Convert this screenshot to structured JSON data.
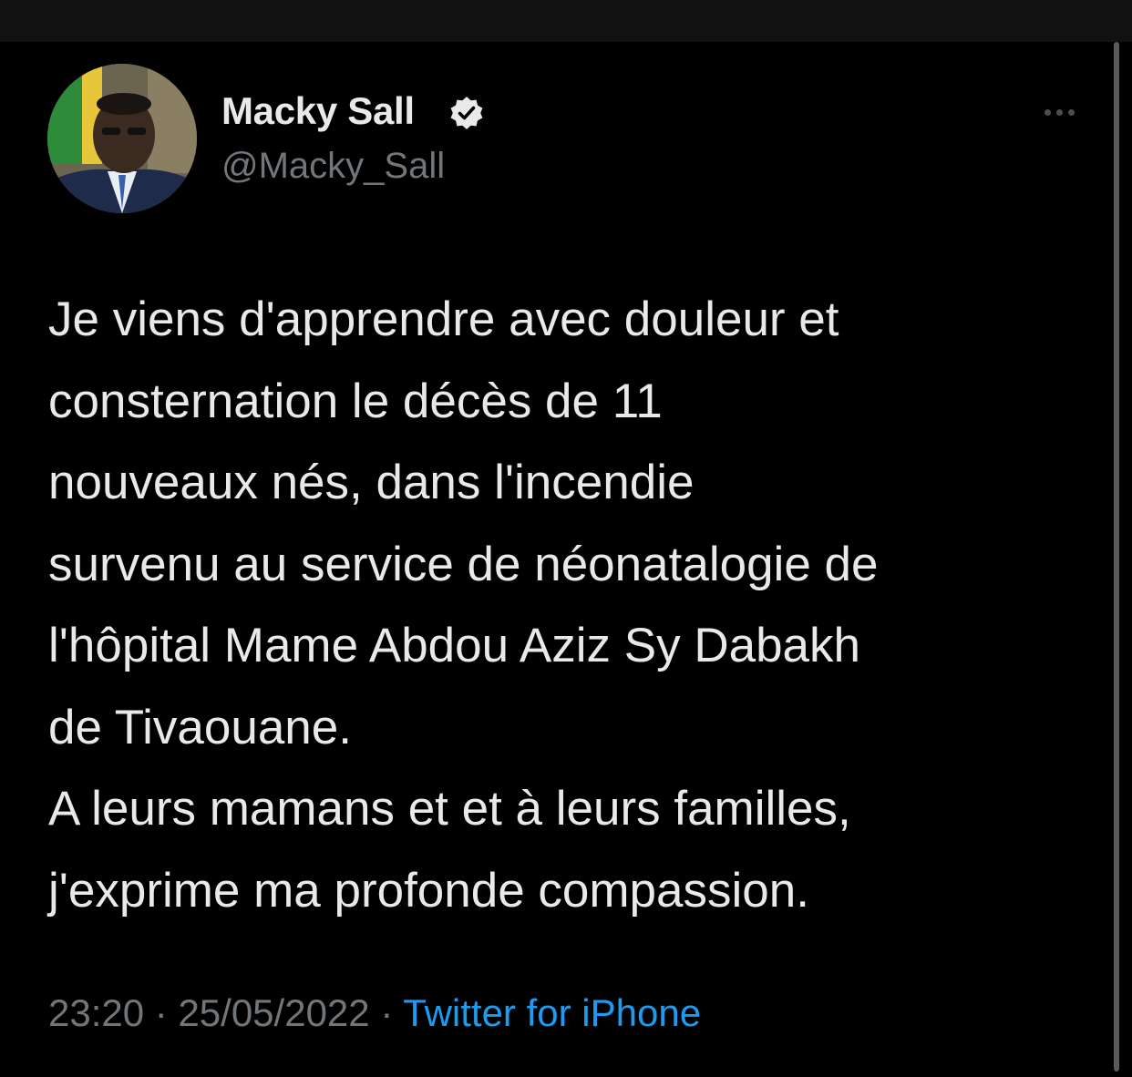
{
  "author": {
    "display_name": "Macky Sall",
    "handle": "@Macky_Sall",
    "verified": true
  },
  "tweet": {
    "lines": [
      "Je viens d'apprendre avec douleur et",
      "consternation le décès de 11",
      "nouveaux nés, dans l'incendie",
      "survenu au service de néonatalogie de",
      "l'hôpital Mame Abdou Aziz Sy Dabakh",
      "de Tivaouane.",
      "A leurs mamans et et à leurs familles,",
      "j'exprime ma profonde compassion."
    ]
  },
  "meta": {
    "time": "23:20",
    "separator": " · ",
    "date": "25/05/2022",
    "source": "Twitter for iPhone"
  },
  "icons": {
    "verified": "verified-badge-icon",
    "more": "more-horizontal-icon"
  },
  "colors": {
    "background": "#000000",
    "text": "#e7e9ea",
    "secondary": "#71767b",
    "link": "#1d9bf0"
  }
}
